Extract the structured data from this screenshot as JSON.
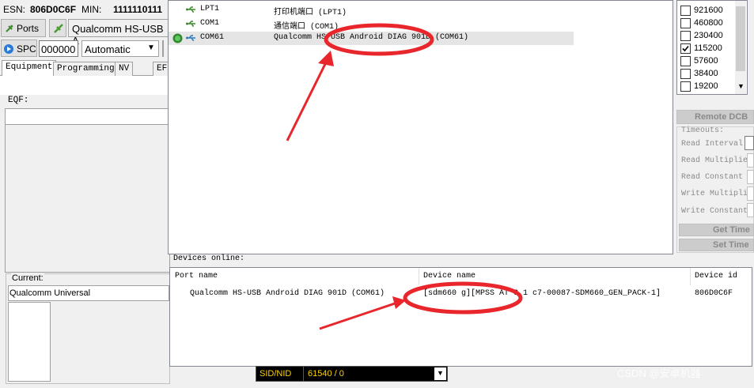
{
  "header": {
    "esn_label": "ESN:",
    "esn_value": "806D0C6F",
    "min_label": "MIN:",
    "min_value": "1111110111"
  },
  "toolbar": {
    "ports_label": "Ports",
    "port_selected": "Qualcomm HS-USB A",
    "spc_label": "SPC",
    "spc_value": "000000",
    "mode_selected": "Automatic"
  },
  "tabs": [
    {
      "label": "Equipment"
    },
    {
      "label": "Programming"
    },
    {
      "label": "NV"
    },
    {
      "label": "EF"
    }
  ],
  "eqf": {
    "label": "EQF:"
  },
  "current": {
    "label": "Current:",
    "value": "Qualcomm Universal"
  },
  "ports": [
    {
      "name": "LPT1",
      "desc": "打印机端口 (LPT1)",
      "selected": false
    },
    {
      "name": "COM1",
      "desc": "通信端口 (COM1)",
      "selected": false
    },
    {
      "name": "COM61",
      "desc": "Qualcomm HS-USB Android DIAG 901D (COM61)",
      "selected": true
    }
  ],
  "devices": {
    "label": "Devices online:",
    "columns": [
      "Port name",
      "Device name",
      "Device id"
    ],
    "rows": [
      {
        "port": "Qualcomm HS-USB Android DIAG 901D (COM61)",
        "device": "[sdm660 g][MPSS AT 3.1 c7-00087-SDM660_GEN_PACK-1]",
        "id": "806D0C6F"
      }
    ]
  },
  "baud_rates": [
    {
      "value": "921600",
      "checked": false
    },
    {
      "value": "460800",
      "checked": false
    },
    {
      "value": "230400",
      "checked": false
    },
    {
      "value": "115200",
      "checked": true
    },
    {
      "value": "57600",
      "checked": false
    },
    {
      "value": "38400",
      "checked": false
    },
    {
      "value": "19200",
      "checked": false
    }
  ],
  "remote_dcb": {
    "label": "Remote DCB"
  },
  "timeouts": {
    "label": "Timeouts:",
    "fields": [
      "Read Interval",
      "Read Multiplier",
      "Read Constant",
      "Write Multipli",
      "Write Constant"
    ],
    "get_label": "Get Time",
    "set_label": "Set Time"
  },
  "status": {
    "sid_label": "SID/NID",
    "sid_value": "61540 / 0"
  },
  "watermark": "CSDN @安卓机器",
  "colors": {
    "annotation": "#e8262c",
    "selection": "#e5e5e5",
    "status_text": "#ffd200"
  }
}
